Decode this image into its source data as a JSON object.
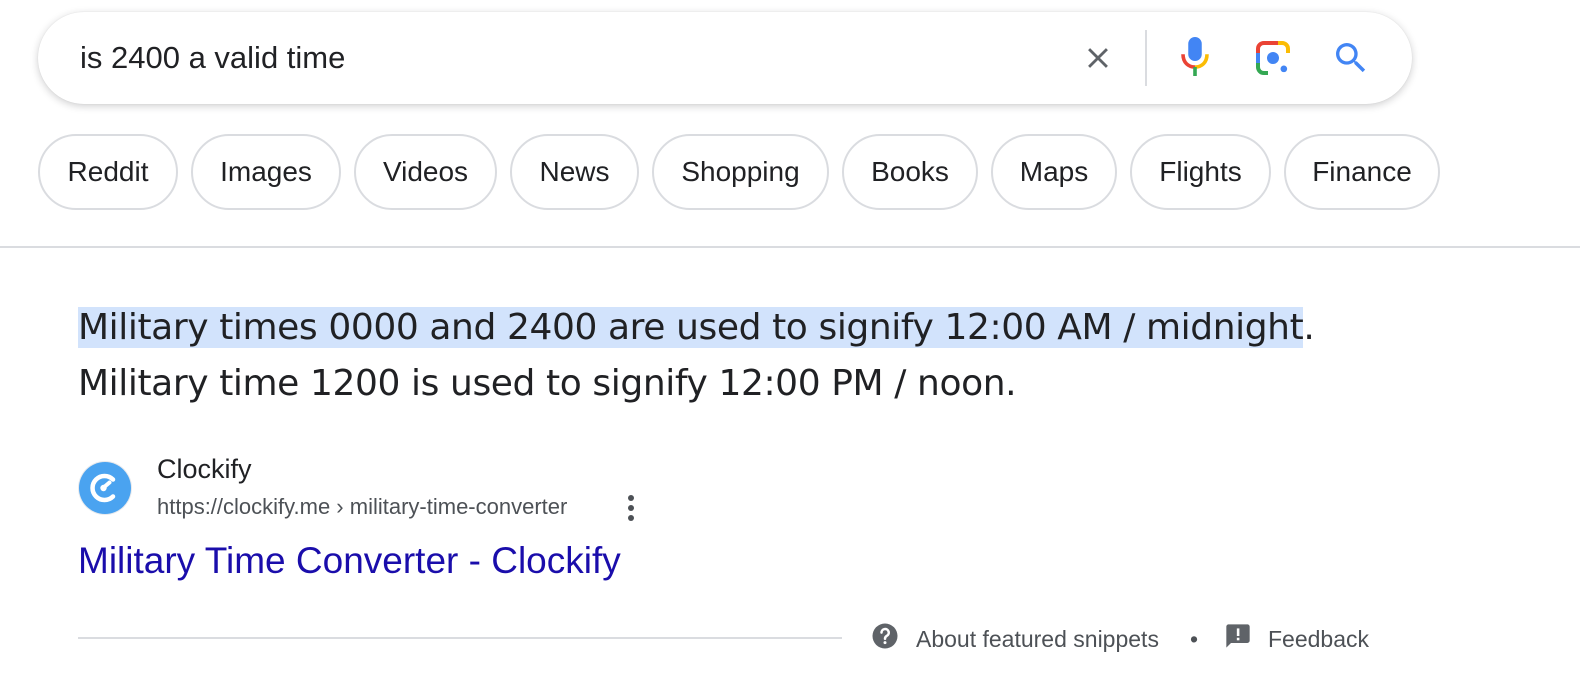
{
  "search": {
    "query": "is 2400 a valid time",
    "icons": {
      "clear": "close-icon",
      "voice": "microphone-icon",
      "lens": "google-lens-icon",
      "submit": "search-icon"
    }
  },
  "chips": [
    {
      "label": "Reddit"
    },
    {
      "label": "Images"
    },
    {
      "label": "Videos"
    },
    {
      "label": "News"
    },
    {
      "label": "Shopping"
    },
    {
      "label": "Books"
    },
    {
      "label": "Maps"
    },
    {
      "label": "Flights"
    },
    {
      "label": "Finance"
    }
  ],
  "snippet": {
    "line1_highlighted": "Military times 0000 and 2400 are used to signify 12:00 AM / midnight",
    "line1_tail": ".",
    "line2": "Military time 1200 is used to signify 12:00 PM / noon."
  },
  "source": {
    "name": "Clockify",
    "url": "https://clockify.me › military-time-converter",
    "favicon": "clockify-logo-icon",
    "favicon_color": "#03a9f4",
    "title": "Military Time Converter - Clockify"
  },
  "footer": {
    "about": "About featured snippets",
    "separator": "•",
    "feedback": "Feedback"
  },
  "colors": {
    "link": "#1a0dab",
    "highlight": "#d2e3fc",
    "search_blue": "#4285f4",
    "text_secondary": "#4d5156"
  }
}
